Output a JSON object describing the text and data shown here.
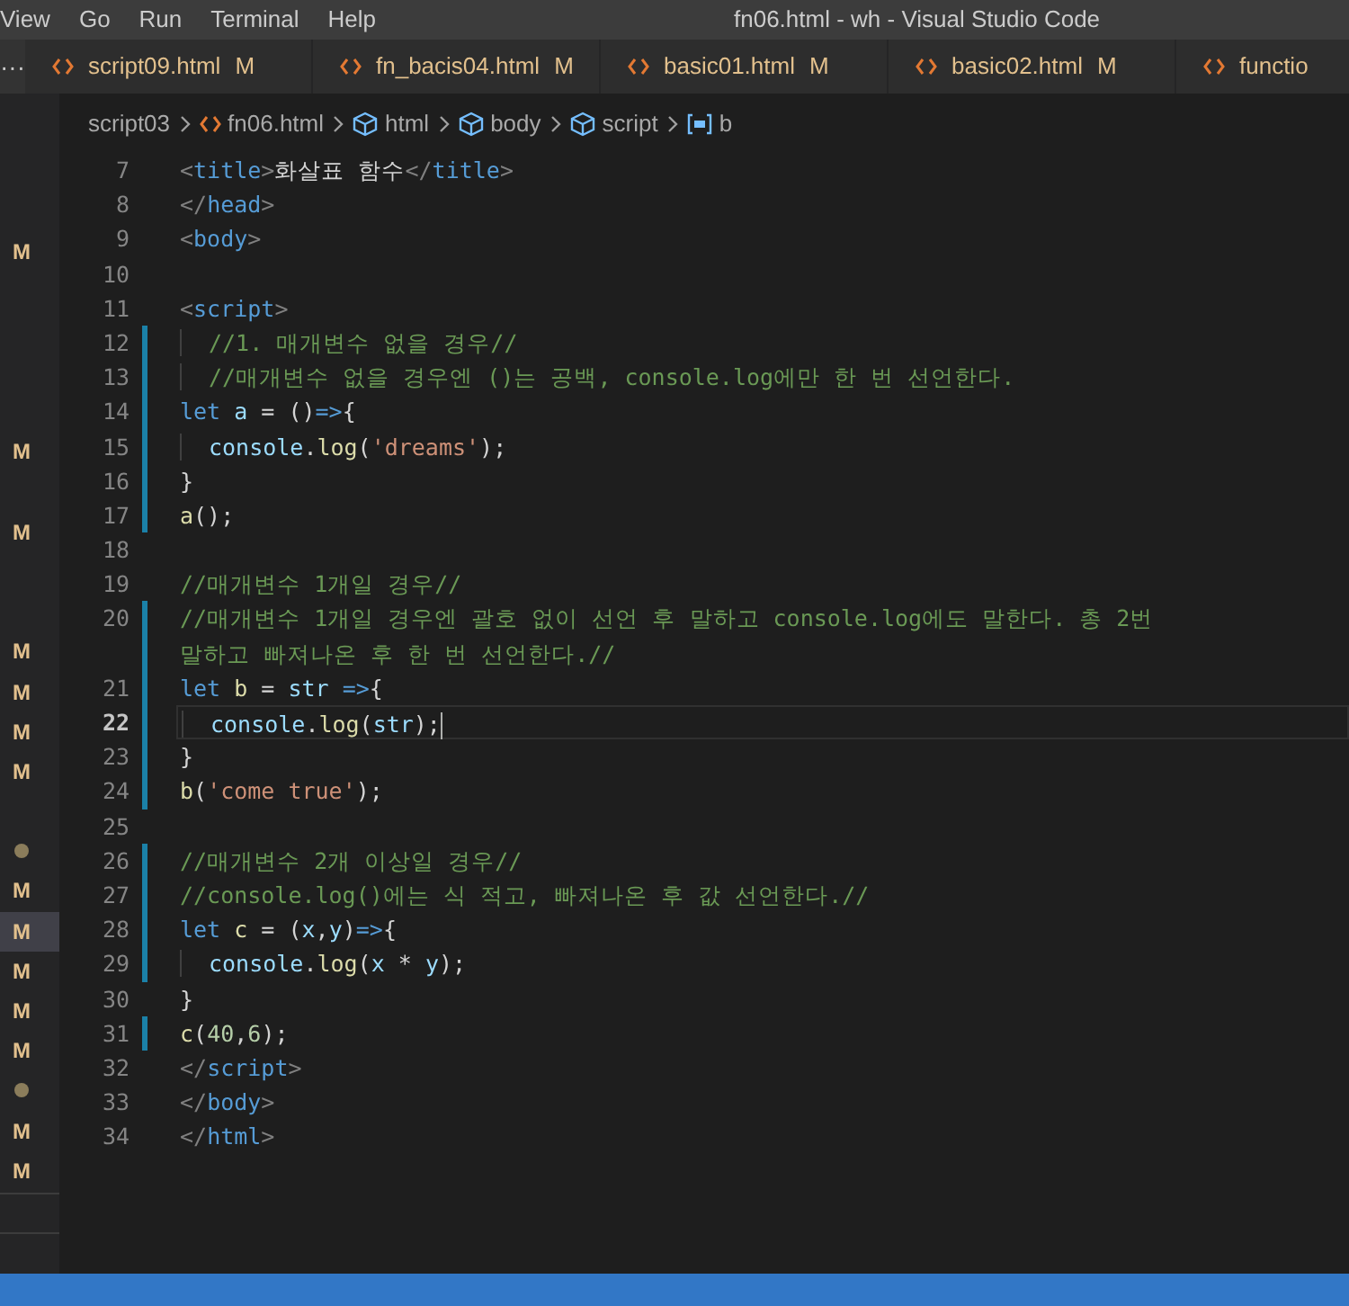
{
  "menu": [
    "View",
    "Go",
    "Run",
    "Terminal",
    "Help"
  ],
  "window": {
    "title": "fn06.html - wh - Visual Studio Code"
  },
  "tab_bar": {
    "more": "···"
  },
  "tabs": [
    {
      "label": "script09.html",
      "badge": "M",
      "selected": false
    },
    {
      "label": "fn_bacis04.html",
      "badge": "M",
      "selected": false
    },
    {
      "label": "basic01.html",
      "badge": "M",
      "selected": false
    },
    {
      "label": "basic02.html",
      "badge": "M",
      "selected": false
    },
    {
      "label": "functio",
      "selected": false
    }
  ],
  "breadcrumbs": [
    {
      "kind": "folder",
      "label": "script03"
    },
    {
      "kind": "file",
      "label": "fn06.html"
    },
    {
      "kind": "element",
      "label": "html"
    },
    {
      "kind": "element",
      "label": "body"
    },
    {
      "kind": "element",
      "label": "script"
    },
    {
      "kind": "variable",
      "label": "b"
    }
  ],
  "explorer_rows": [
    {
      "kind": "blank"
    },
    {
      "kind": "blank"
    },
    {
      "kind": "modified",
      "badge": "M",
      "selected": false
    },
    {
      "kind": "blank"
    },
    {
      "kind": "blank"
    },
    {
      "kind": "blank"
    },
    {
      "kind": "blank"
    },
    {
      "kind": "modified",
      "badge": "M",
      "selected": false
    },
    {
      "kind": "blank"
    },
    {
      "kind": "modified",
      "badge": "M",
      "selected": false
    },
    {
      "kind": "blank"
    },
    {
      "kind": "blank"
    },
    {
      "kind": "modified",
      "badge": "M",
      "selected": false
    },
    {
      "kind": "modified",
      "badge": "M",
      "selected": false
    },
    {
      "kind": "modified",
      "badge": "M",
      "selected": false
    },
    {
      "kind": "modified",
      "badge": "M",
      "selected": false
    },
    {
      "kind": "blank"
    },
    {
      "kind": "dot",
      "selected": false
    },
    {
      "kind": "modified",
      "badge": "M",
      "selected": false
    },
    {
      "kind": "modified",
      "badge": "M",
      "selected": true
    },
    {
      "kind": "modified",
      "badge": "M",
      "selected": false
    },
    {
      "kind": "modified",
      "badge": "M",
      "selected": false
    },
    {
      "kind": "modified",
      "badge": "M",
      "selected": false
    },
    {
      "kind": "dot",
      "selected": false
    },
    {
      "kind": "modified",
      "badge": "M",
      "selected": false
    },
    {
      "kind": "modified",
      "badge": "M",
      "selected": false
    }
  ],
  "editor_lines": [
    {
      "number": "7",
      "changed": false,
      "current": false,
      "tokens": [
        {
          "kind": "punct",
          "text": "<"
        },
        {
          "kind": "tag",
          "text": "title"
        },
        {
          "kind": "punct",
          "text": ">"
        },
        {
          "kind": "text",
          "text": "화살표 함수"
        },
        {
          "kind": "punct",
          "text": "</"
        },
        {
          "kind": "tag",
          "text": "title"
        },
        {
          "kind": "punct",
          "text": ">"
        }
      ]
    },
    {
      "number": "8",
      "changed": false,
      "current": false,
      "tokens": [
        {
          "kind": "punct",
          "text": "</"
        },
        {
          "kind": "tag",
          "text": "head"
        },
        {
          "kind": "punct",
          "text": ">"
        }
      ]
    },
    {
      "number": "9",
      "changed": false,
      "current": false,
      "tokens": [
        {
          "kind": "punct",
          "text": "<"
        },
        {
          "kind": "tag",
          "text": "body"
        },
        {
          "kind": "punct",
          "text": ">"
        }
      ]
    },
    {
      "number": "10",
      "changed": false,
      "current": false
    },
    {
      "number": "11",
      "changed": false,
      "current": false,
      "tokens": [
        {
          "kind": "punct",
          "text": "<"
        },
        {
          "kind": "tag",
          "text": "script"
        },
        {
          "kind": "punct",
          "text": ">"
        }
      ]
    },
    {
      "number": "12",
      "changed": true,
      "current": false,
      "indent": true,
      "tokens": [
        {
          "kind": "comment",
          "text": "//1. 매개변수 없을 경우//"
        }
      ]
    },
    {
      "number": "13",
      "changed": true,
      "current": false,
      "indent": true,
      "tokens": [
        {
          "kind": "comment",
          "text": "//매개변수 없을 경우엔 ()는 공백, console.log에만 한 번 선언한다."
        }
      ]
    },
    {
      "number": "14",
      "changed": true,
      "current": false,
      "tokens": [
        {
          "kind": "kw",
          "text": "let"
        },
        {
          "kind": "var",
          "text": " a"
        },
        {
          "kind": "text",
          "text": " = ()"
        },
        {
          "kind": "kw",
          "text": "=>"
        },
        {
          "kind": "text",
          "text": "{"
        }
      ]
    },
    {
      "number": "15",
      "changed": true,
      "current": false,
      "indent": true,
      "tokens": [
        {
          "kind": "var",
          "text": "console"
        },
        {
          "kind": "text",
          "text": "."
        },
        {
          "kind": "fn",
          "text": "log"
        },
        {
          "kind": "text",
          "text": "("
        },
        {
          "kind": "str",
          "text": "'dreams'"
        },
        {
          "kind": "text",
          "text": ");"
        }
      ]
    },
    {
      "number": "16",
      "changed": true,
      "current": false,
      "tokens": [
        {
          "kind": "text",
          "text": "}"
        }
      ]
    },
    {
      "number": "17",
      "changed": true,
      "current": false,
      "tokens": [
        {
          "kind": "fn",
          "text": "a"
        },
        {
          "kind": "text",
          "text": "();"
        }
      ]
    },
    {
      "number": "18",
      "changed": false,
      "current": false
    },
    {
      "number": "19",
      "changed": false,
      "current": false,
      "tokens": [
        {
          "kind": "comment",
          "text": "//매개변수 1개일 경우//"
        }
      ]
    },
    {
      "number": "20",
      "changed": true,
      "current": false,
      "tokens": [
        {
          "kind": "comment",
          "text": "//매개변수 1개일 경우엔 괄호 없이 선언 후 말하고 console.log에도 말한다. 총 2번"
        }
      ],
      "wrap_tokens": [
        {
          "kind": "comment",
          "text": "말하고 빠져나온 후 한 번 선언한다.//"
        }
      ]
    },
    {
      "number": "21",
      "changed": true,
      "current": false,
      "tokens": [
        {
          "kind": "kw",
          "text": "let"
        },
        {
          "kind": "fn",
          "text": " b"
        },
        {
          "kind": "text",
          "text": " = "
        },
        {
          "kind": "var",
          "text": "str"
        },
        {
          "kind": "kw",
          "text": " =>"
        },
        {
          "kind": "text",
          "text": "{"
        }
      ]
    },
    {
      "number": "22",
      "changed": true,
      "current": true,
      "indent": true,
      "tokens": [
        {
          "kind": "var",
          "text": "console"
        },
        {
          "kind": "text",
          "text": "."
        },
        {
          "kind": "fn",
          "text": "log"
        },
        {
          "kind": "text",
          "text": "("
        },
        {
          "kind": "var",
          "text": "str"
        },
        {
          "kind": "text",
          "text": ");"
        }
      ]
    },
    {
      "number": "23",
      "changed": true,
      "current": false,
      "tokens": [
        {
          "kind": "text",
          "text": "}"
        }
      ]
    },
    {
      "number": "24",
      "changed": true,
      "current": false,
      "tokens": [
        {
          "kind": "fn",
          "text": "b"
        },
        {
          "kind": "text",
          "text": "("
        },
        {
          "kind": "str",
          "text": "'come true'"
        },
        {
          "kind": "text",
          "text": ");"
        }
      ]
    },
    {
      "number": "25",
      "changed": false,
      "current": false
    },
    {
      "number": "26",
      "changed": true,
      "current": false,
      "tokens": [
        {
          "kind": "comment",
          "text": "//매개변수 2개 이상일 경우//"
        }
      ]
    },
    {
      "number": "27",
      "changed": true,
      "current": false,
      "tokens": [
        {
          "kind": "comment",
          "text": "//console.log()에는 식 적고, 빠져나온 후 값 선언한다.//"
        }
      ]
    },
    {
      "number": "28",
      "changed": true,
      "current": false,
      "tokens": [
        {
          "kind": "kw",
          "text": "let"
        },
        {
          "kind": "fn",
          "text": " c"
        },
        {
          "kind": "text",
          "text": " = ("
        },
        {
          "kind": "var",
          "text": "x"
        },
        {
          "kind": "text",
          "text": ","
        },
        {
          "kind": "var",
          "text": "y"
        },
        {
          "kind": "text",
          "text": ")"
        },
        {
          "kind": "kw",
          "text": "=>"
        },
        {
          "kind": "text",
          "text": "{"
        }
      ]
    },
    {
      "number": "29",
      "changed": true,
      "current": false,
      "indent": true,
      "tokens": [
        {
          "kind": "var",
          "text": "console"
        },
        {
          "kind": "text",
          "text": "."
        },
        {
          "kind": "fn",
          "text": "log"
        },
        {
          "kind": "text",
          "text": "("
        },
        {
          "kind": "var",
          "text": "x"
        },
        {
          "kind": "text",
          "text": " * "
        },
        {
          "kind": "var",
          "text": "y"
        },
        {
          "kind": "text",
          "text": ");"
        }
      ]
    },
    {
      "number": "30",
      "changed": false,
      "current": false,
      "tokens": [
        {
          "kind": "text",
          "text": "}"
        }
      ]
    },
    {
      "number": "31",
      "changed": true,
      "current": false,
      "tokens": [
        {
          "kind": "fn",
          "text": "c"
        },
        {
          "kind": "text",
          "text": "("
        },
        {
          "kind": "num",
          "text": "40"
        },
        {
          "kind": "text",
          "text": ","
        },
        {
          "kind": "num",
          "text": "6"
        },
        {
          "kind": "text",
          "text": ");"
        }
      ]
    },
    {
      "number": "32",
      "changed": false,
      "current": false,
      "tokens": [
        {
          "kind": "punct",
          "text": "</"
        },
        {
          "kind": "tag",
          "text": "script"
        },
        {
          "kind": "punct",
          "text": ">"
        }
      ]
    },
    {
      "number": "33",
      "changed": false,
      "current": false,
      "tokens": [
        {
          "kind": "punct",
          "text": "</"
        },
        {
          "kind": "tag",
          "text": "body"
        },
        {
          "kind": "punct",
          "text": ">"
        }
      ]
    },
    {
      "number": "34",
      "changed": false,
      "current": false,
      "tokens": [
        {
          "kind": "punct",
          "text": "</"
        },
        {
          "kind": "tag",
          "text": "html"
        },
        {
          "kind": "punct",
          "text": ">"
        }
      ]
    }
  ]
}
